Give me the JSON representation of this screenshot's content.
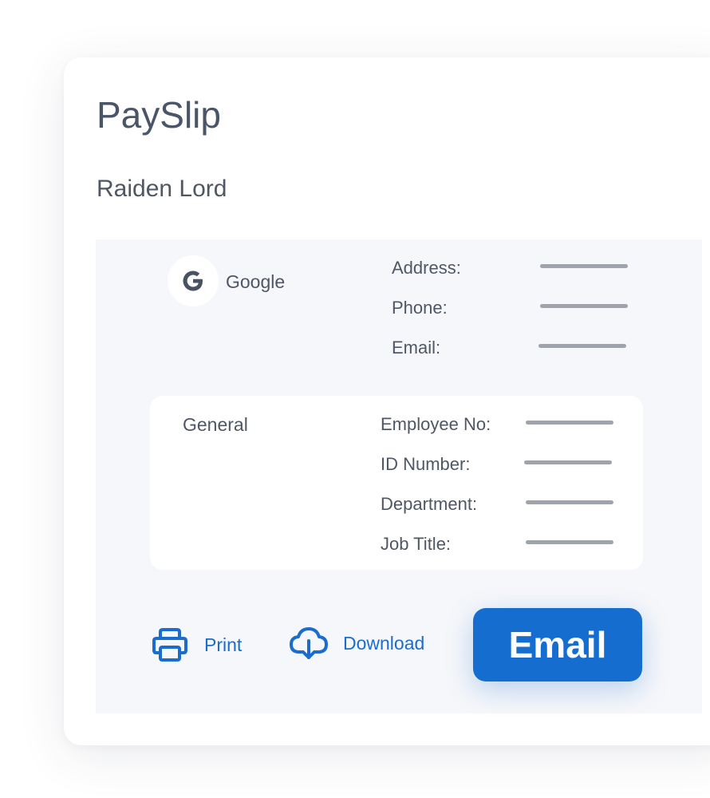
{
  "header": {
    "title": "PaySlip",
    "employee_name": "Raiden Lord"
  },
  "company": {
    "logo_letter": "G",
    "name": "Google",
    "contact_labels": [
      "Address:",
      "Phone:",
      "Email:"
    ]
  },
  "general": {
    "title": "General",
    "labels": [
      "Employee No:",
      "ID Number:",
      "Department:",
      "Job Title:"
    ]
  },
  "actions": {
    "print_label": "Print",
    "download_label": "Download",
    "email_label": "Email"
  },
  "colors": {
    "accent": "#156dcf",
    "link": "#1a6dcc",
    "text": "#4f5765",
    "placeholder_line": "#9ea3ad",
    "panel_background": "#f6f7fa"
  },
  "icons": {
    "logo": "google-logo-icon",
    "print": "printer-icon",
    "download": "cloud-download-icon"
  }
}
